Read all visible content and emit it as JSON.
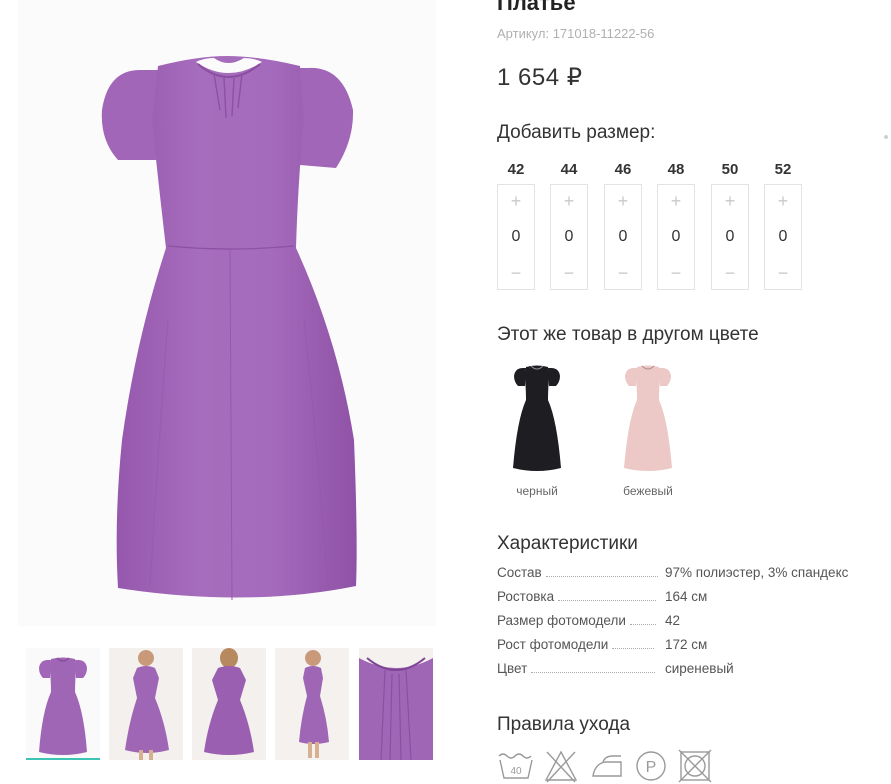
{
  "product": {
    "title": "Платье",
    "sku": "Артикул: 171018-11222-56",
    "price": "1 654 ₽",
    "main_color": "#a066b6"
  },
  "sizes": {
    "heading": "Добавить размер:",
    "items": [
      {
        "size": "42",
        "qty": "0",
        "plus": "+",
        "minus": "−"
      },
      {
        "size": "44",
        "qty": "0",
        "plus": "+",
        "minus": "−"
      },
      {
        "size": "46",
        "qty": "0",
        "plus": "+",
        "minus": "−"
      },
      {
        "size": "48",
        "qty": "0",
        "plus": "+",
        "minus": "−"
      },
      {
        "size": "50",
        "qty": "0",
        "plus": "+",
        "minus": "−"
      },
      {
        "size": "52",
        "qty": "0",
        "plus": "+",
        "minus": "−"
      }
    ]
  },
  "colors": {
    "heading": "Этот же товар в другом цвете",
    "items": [
      {
        "label": "черный",
        "color": "#1d1d22"
      },
      {
        "label": "бежевый",
        "color": "#ecc9c6"
      }
    ]
  },
  "specs": {
    "heading": "Характеристики",
    "rows": [
      {
        "name": "Состав",
        "value": "97% полиэстер, 3% спандекс"
      },
      {
        "name": "Ростовка",
        "value": "164 см"
      },
      {
        "name": "Размер фотомодели",
        "value": "42"
      },
      {
        "name": "Рост фотомодели",
        "value": "172 см"
      },
      {
        "name": "Цвет",
        "value": "сиреневый"
      }
    ]
  },
  "care": {
    "heading": "Правила ухода",
    "icons": [
      "wash-40-icon",
      "no-bleach-icon",
      "iron-icon",
      "professional-clean-p-icon",
      "no-tumble-dry-icon"
    ],
    "wash_temp": "40",
    "dry_clean_letter": "P"
  },
  "gallery": {
    "thumbs": [
      "front",
      "model-front",
      "model-back",
      "model-side",
      "detail"
    ],
    "accent": "#3cc4b4"
  }
}
